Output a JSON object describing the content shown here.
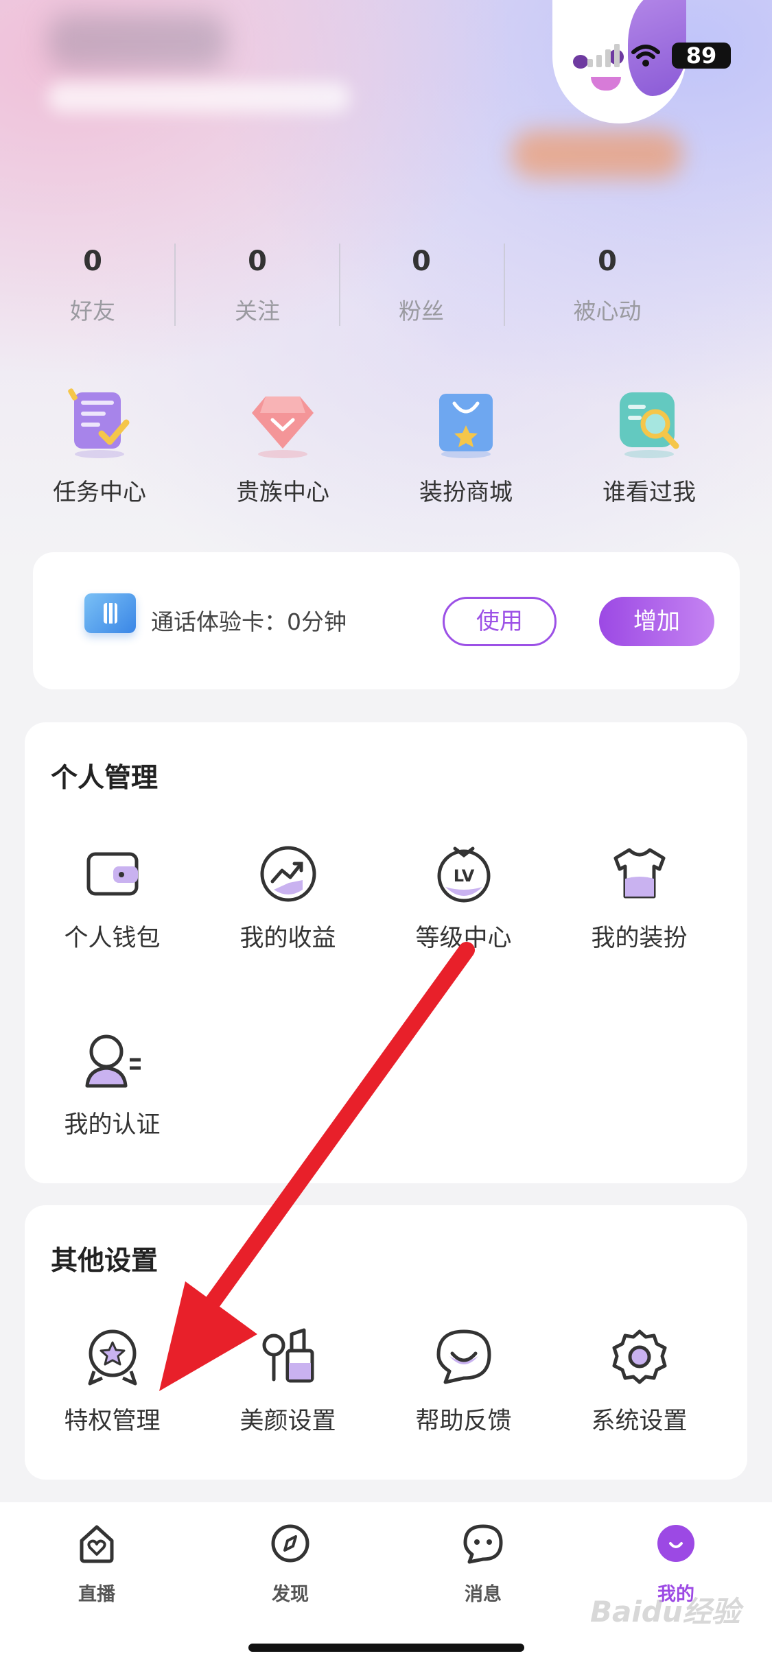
{
  "status": {
    "battery": "89"
  },
  "stats": [
    {
      "value": "0",
      "label": "好友"
    },
    {
      "value": "0",
      "label": "关注"
    },
    {
      "value": "0",
      "label": "粉丝"
    },
    {
      "value": "0",
      "label": "被心动"
    }
  ],
  "quick_menu": [
    {
      "label": "任务中心",
      "icon": "task-icon"
    },
    {
      "label": "贵族中心",
      "icon": "diamond-icon"
    },
    {
      "label": "装扮商城",
      "icon": "shopping-bag-icon"
    },
    {
      "label": "谁看过我",
      "icon": "magnifier-icon"
    }
  ],
  "call_card": {
    "text": "通话体验卡：0分钟",
    "use_label": "使用",
    "add_label": "增加"
  },
  "personal": {
    "title": "个人管理",
    "items": [
      {
        "label": "个人钱包",
        "icon": "wallet-icon"
      },
      {
        "label": "我的收益",
        "icon": "earnings-icon"
      },
      {
        "label": "等级中心",
        "icon": "level-icon"
      },
      {
        "label": "我的装扮",
        "icon": "tshirt-icon"
      },
      {
        "label": "我的认证",
        "icon": "verify-user-icon"
      }
    ]
  },
  "other": {
    "title": "其他设置",
    "items": [
      {
        "label": "特权管理",
        "icon": "badge-icon"
      },
      {
        "label": "美颜设置",
        "icon": "makeup-icon"
      },
      {
        "label": "帮助反馈",
        "icon": "feedback-icon"
      },
      {
        "label": "系统设置",
        "icon": "gear-icon"
      }
    ]
  },
  "tabs": [
    {
      "label": "直播",
      "icon": "house-heart-icon"
    },
    {
      "label": "发现",
      "icon": "compass-icon"
    },
    {
      "label": "消息",
      "icon": "chat-icon"
    },
    {
      "label": "我的",
      "icon": "profile-icon",
      "active": true
    }
  ],
  "colors": {
    "accent": "#9c49e4",
    "arrow": "#e8202a"
  },
  "watermark": "Baidu经验"
}
